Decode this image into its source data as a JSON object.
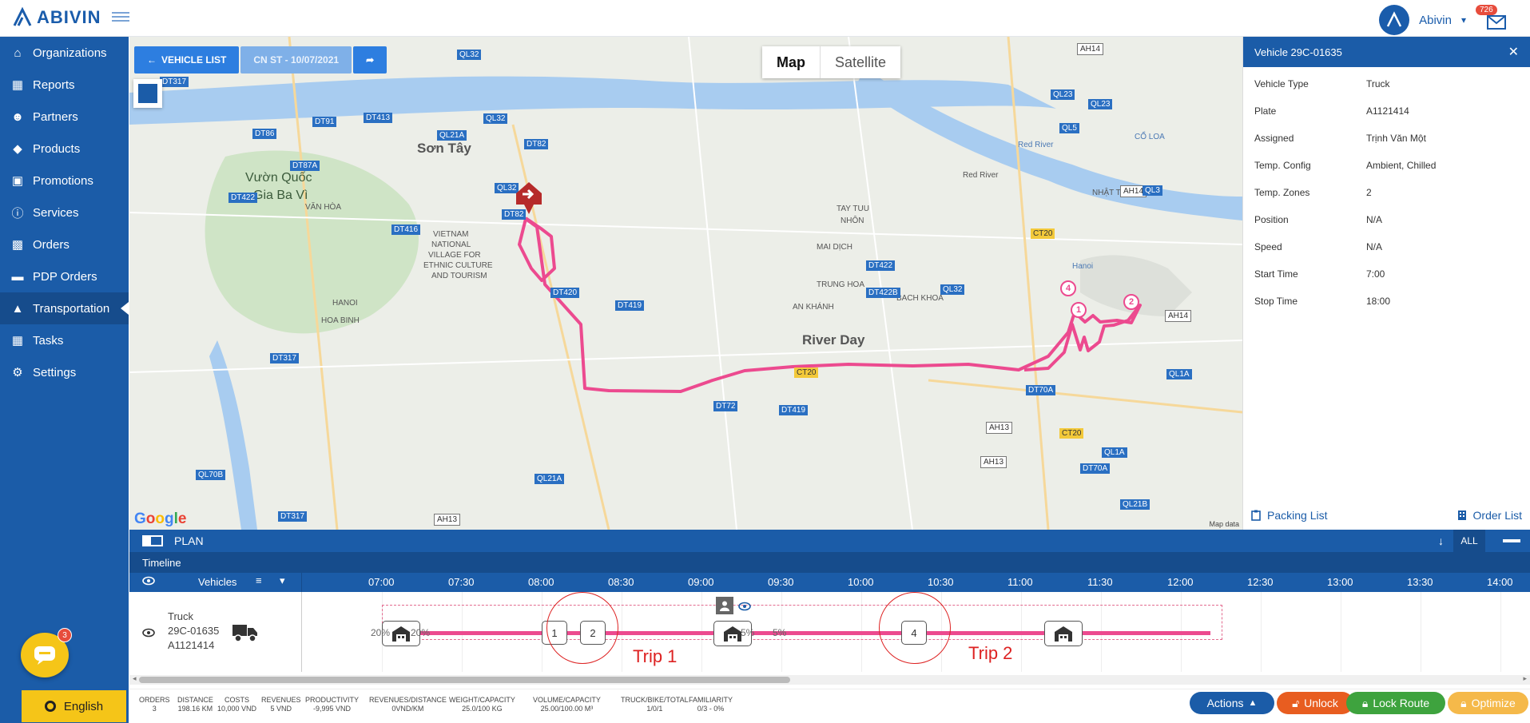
{
  "app": {
    "brand": "ABIVIN",
    "user": "Abivin",
    "notif_count": "726"
  },
  "sidebar": {
    "items": [
      {
        "label": "Organizations",
        "icon": "home-icon"
      },
      {
        "label": "Reports",
        "icon": "bar-chart-icon"
      },
      {
        "label": "Partners",
        "icon": "users-icon"
      },
      {
        "label": "Products",
        "icon": "dropbox-icon"
      },
      {
        "label": "Promotions",
        "icon": "gift-icon"
      },
      {
        "label": "Services",
        "icon": "info-icon"
      },
      {
        "label": "Orders",
        "icon": "cubes-icon"
      },
      {
        "label": "PDP Orders",
        "icon": "truck-icon"
      },
      {
        "label": "Transportation",
        "icon": "road-icon"
      },
      {
        "label": "Tasks",
        "icon": "calendar-icon"
      },
      {
        "label": "Settings",
        "icon": "gear-icon"
      }
    ],
    "chat_badge": "3",
    "language": "English"
  },
  "map": {
    "vehicle_list_label": "VEHICLE LIST",
    "plan_label": "CN ST - 10/07/2021",
    "tab_map": "Map",
    "tab_satellite": "Satellite",
    "google": "Google",
    "mapdata": "Map data",
    "labels": [
      "Sơn Tây",
      "Vườn Quốc",
      "Gia Ba Vì",
      "VĂN HÒA",
      "VIETNAM",
      "NATIONAL",
      "VILLAGE FOR",
      "ETHNIC CULTURE",
      "AND TOURISM",
      "TAY TUU",
      "NHÔN",
      "MAI DỊCH",
      "TRUNG HOA",
      "BACH KHOA",
      "AN KHÁNH",
      "NHẬT TÂN",
      "CỔ LOA",
      "Red River",
      "River Day",
      "Hanoi",
      "HANOI",
      "HOA BINH",
      "Red River"
    ],
    "roads": [
      "QL32",
      "DT317",
      "DT86",
      "DT91",
      "DT413",
      "QL21A",
      "QL32",
      "DT82",
      "DT87A",
      "DT422",
      "DT416",
      "DT82",
      "QL32",
      "DT420",
      "DT419",
      "DT422",
      "DT422B",
      "QL32",
      "DT72",
      "DT419",
      "DT70A",
      "AH13",
      "AH13",
      "CT20",
      "QL1A",
      "DT70A",
      "QL21B",
      "QL21A",
      "AH13",
      "QL70B",
      "DT317",
      "DT317",
      "AH14",
      "QL23",
      "QL23",
      "QL5",
      "AH14",
      "QL3",
      "AH14",
      "QL1A",
      "CT20",
      "CT20"
    ],
    "stops": [
      "1",
      "2",
      "4"
    ]
  },
  "panel": {
    "title": "Vehicle 29C-01635",
    "rows": [
      {
        "k": "Vehicle Type",
        "v": "Truck"
      },
      {
        "k": "Plate",
        "v": "A1121414"
      },
      {
        "k": "Assigned",
        "v": "Trịnh Văn Một"
      },
      {
        "k": "Temp. Config",
        "v": "Ambient, Chilled"
      },
      {
        "k": "Temp. Zones",
        "v": "2"
      },
      {
        "k": "Position",
        "v": "N/A"
      },
      {
        "k": "Speed",
        "v": "N/A"
      },
      {
        "k": "Start Time",
        "v": "7:00"
      },
      {
        "k": "Stop Time",
        "v": "18:00"
      }
    ],
    "packing_list": "Packing List",
    "order_list": "Order List"
  },
  "plan": {
    "title": "PLAN",
    "all": "ALL",
    "timeline": "Timeline",
    "vehicles": "Vehicles",
    "times": [
      "07:00",
      "07:30",
      "08:00",
      "08:30",
      "09:00",
      "09:30",
      "10:00",
      "10:30",
      "11:00",
      "11:30",
      "12:00",
      "12:30",
      "13:00",
      "13:30",
      "14:00"
    ],
    "vehicle": {
      "type": "Truck",
      "name": "29C-01635",
      "plate": "A1121414"
    },
    "stops": [
      "1",
      "2",
      "4"
    ],
    "pct": [
      "20%",
      "20%",
      "5%",
      "5%"
    ],
    "trip1": "Trip 1",
    "trip2": "Trip 2"
  },
  "stats": [
    {
      "k": "ORDERS",
      "v": "3"
    },
    {
      "k": "DISTANCE",
      "v": "198.16 KM"
    },
    {
      "k": "COSTS",
      "v": "10,000 VND"
    },
    {
      "k": "REVENUES",
      "v": "5 VND"
    },
    {
      "k": "PRODUCTIVITY",
      "v": "-9,995 VND"
    },
    {
      "k": "REVENUES/DISTANCE",
      "v": "0VND/KM"
    },
    {
      "k": "WEIGHT/CAPACITY",
      "v": "25.0/100 KG"
    },
    {
      "k": "VOLUME/CAPACITY",
      "v": "25.00/100.00 M³"
    },
    {
      "k": "TRUCK/BIKE/TOTAL",
      "v": "1/0/1"
    },
    {
      "k": "FAMILIARITY",
      "v": "0/3 - 0%"
    }
  ],
  "actions": {
    "actions": "Actions",
    "unlock": "Unlock",
    "lock_route": "Lock Route",
    "optimize": "Optimize"
  },
  "colors": {
    "primary": "#1b5ca8",
    "route": "#ec4a8f",
    "unlock": "#e85d20",
    "lock": "#3ea33e",
    "optimize": "#f5b94a",
    "actions": "#1b5ca8"
  }
}
